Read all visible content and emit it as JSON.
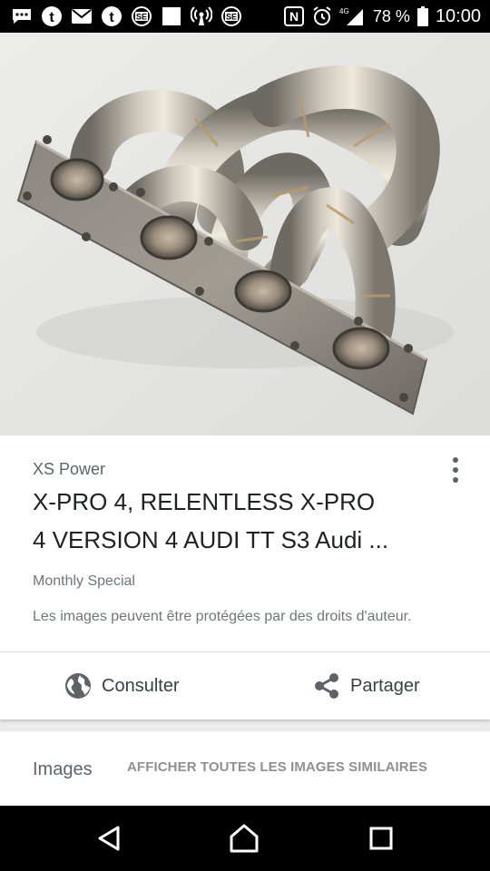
{
  "status_bar": {
    "notification_icons": [
      "messages-icon",
      "tumblr-icon",
      "email-icon",
      "tumblr-icon",
      "se-app-icon",
      "square-app-icon",
      "hotspot-icon",
      "se-app-icon"
    ],
    "nfc": "N",
    "network": "4G",
    "battery_percent": "78 %",
    "time": "10:00"
  },
  "result": {
    "source": "XS Power",
    "title_line1": "X-PRO 4, RELENTLESS X-PRO",
    "title_line2": "4 VERSION 4 AUDI TT S3 Audi ...",
    "subtitle": "Monthly Special",
    "copyright_notice": "Les images peuvent être protégées par des droits d'auteur."
  },
  "actions": {
    "consult_label": "Consulter",
    "share_label": "Partager"
  },
  "images_section": {
    "label": "Images",
    "similar_link": "AFFICHER TOUTES LES IMAGES SIMILAIRES"
  },
  "colors": {
    "accent_text": "#202124",
    "secondary_text": "#5f6368",
    "background": "#ececec"
  }
}
